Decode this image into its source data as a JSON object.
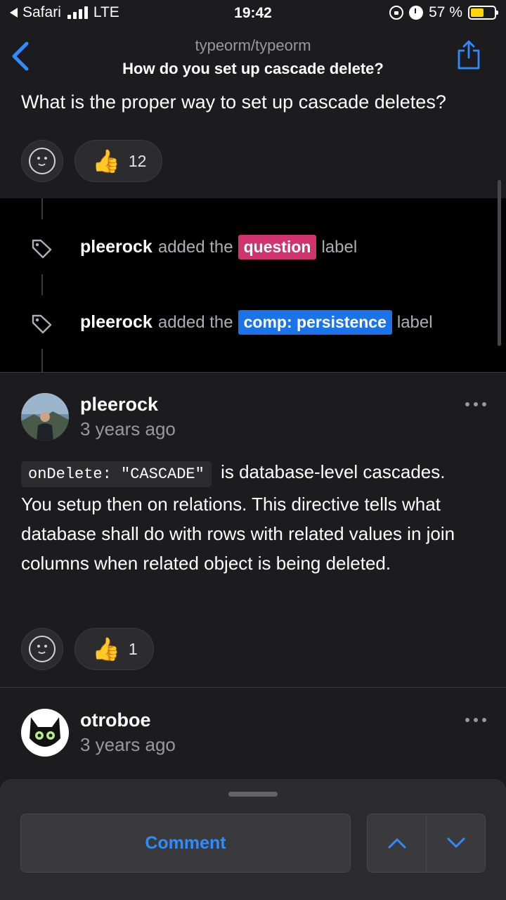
{
  "status_bar": {
    "carrier": "Safari",
    "network": "LTE",
    "time": "19:42",
    "battery": "57 %",
    "battery_level": 0.57,
    "battery_color": "#ffd60a"
  },
  "nav": {
    "subtitle": "typeorm/typeorm",
    "title": "How do you set up cascade delete?",
    "back_icon": "chevron-left-icon",
    "share_icon": "share-icon"
  },
  "question": {
    "text": "What is the proper way to set up cascade deletes?",
    "reactions": {
      "thumbs_up": "👍",
      "thumbs_up_count": "12"
    }
  },
  "timeline": [
    {
      "user": "pleerock",
      "action": "added the",
      "label": "question",
      "label_color": "#d0336e",
      "suffix": "label"
    },
    {
      "user": "pleerock",
      "action": "added the",
      "label": "comp: persistence",
      "label_color": "#1a73e8",
      "suffix": "label"
    }
  ],
  "comments": [
    {
      "author": "pleerock",
      "time": "3 years ago",
      "code": "onDelete: \"CASCADE\"",
      "body": "is database-level cascades. You setup then on relations. This directive tells what database shall do with rows with related values in join columns when related object is being deleted.",
      "thumbs_up": "👍",
      "thumbs_up_count": "1"
    },
    {
      "author": "otroboe",
      "time": "3 years ago"
    }
  ],
  "bottom_bar": {
    "comment_label": "Comment",
    "accent_color": "#2f8cff"
  }
}
